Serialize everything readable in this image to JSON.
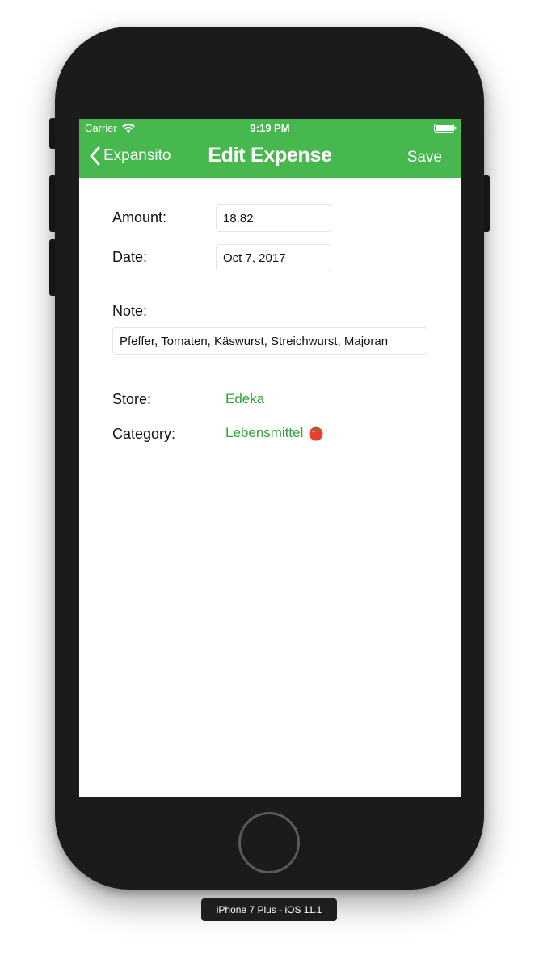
{
  "status_bar": {
    "carrier": "Carrier",
    "time": "9:19 PM"
  },
  "nav": {
    "back_label": "Expansito",
    "title": "Edit Expense",
    "save_label": "Save"
  },
  "form": {
    "amount_label": "Amount:",
    "amount_value": "18.82",
    "date_label": "Date:",
    "date_value": "Oct 7, 2017",
    "note_label": "Note:",
    "note_value": "Pfeffer, Tomaten, Käswurst, Streichwurst, Majoran",
    "store_label": "Store:",
    "store_value": "Edeka",
    "category_label": "Category:",
    "category_value": "Lebensmittel",
    "category_icon": "tomato-icon"
  },
  "device_caption": "iPhone 7 Plus - iOS 11.1",
  "colors": {
    "nav_bar": "#46b84d",
    "link": "#2fa23b",
    "device_body": "#1b1b1b"
  }
}
